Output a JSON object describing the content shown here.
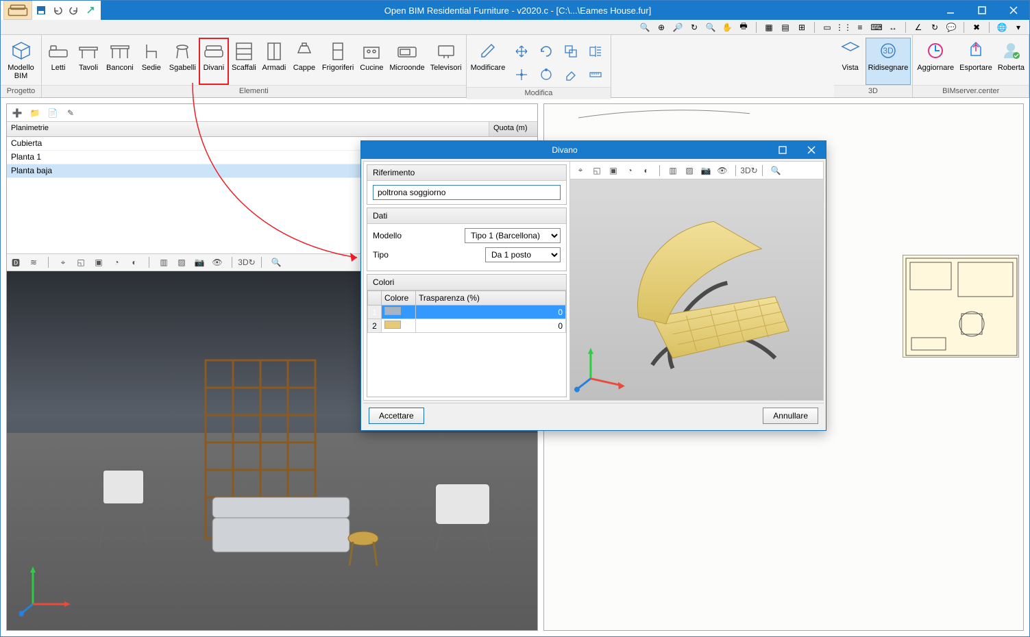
{
  "title": "Open BIM Residential Furniture - v2020.c - [C:\\...\\Eames House.fur]",
  "ribbon": {
    "groups": {
      "progetto": {
        "label": "Progetto",
        "items": [
          "Modello BIM"
        ],
        "names": [
          "modello-bim"
        ]
      },
      "elementi": {
        "label": "Elementi",
        "items": [
          "Letti",
          "Tavoli",
          "Banconi",
          "Sedie",
          "Sgabelli",
          "Divani",
          "Scaffali",
          "Armadi",
          "Cappe",
          "Frigoriferi",
          "Cucine",
          "Microonde",
          "Televisori"
        ],
        "names": [
          "letti",
          "tavoli",
          "banconi",
          "sedie",
          "sgabelli",
          "divani",
          "scaffali",
          "armadi",
          "cappe",
          "frigoriferi",
          "cucine",
          "microonde",
          "televisori"
        ]
      },
      "modifica": {
        "label": "Modifica",
        "modifyLabel": "Modificare"
      },
      "tred": {
        "label": "3D",
        "items": [
          "Vista",
          "Ridisegnare"
        ],
        "names": [
          "vista",
          "ridisegnare"
        ]
      },
      "bim": {
        "label": "BIMserver.center",
        "items": [
          "Aggiornare",
          "Esportare",
          "Roberta"
        ],
        "names": [
          "aggiornare",
          "esportare",
          "roberta"
        ]
      }
    }
  },
  "tree": {
    "header": {
      "name": "Planimetrie",
      "quota": "Quota (m)"
    },
    "rows": [
      "Cubierta",
      "Planta 1",
      "Planta baja"
    ],
    "selected": 2
  },
  "dialog": {
    "title": "Divano",
    "sections": {
      "riferimento": {
        "label": "Riferimento",
        "value": "poltrona soggiorno"
      },
      "dati": {
        "label": "Dati",
        "modello": {
          "label": "Modello",
          "value": "Tipo 1 (Barcellona)"
        },
        "tipo": {
          "label": "Tipo",
          "value": "Da 1 posto"
        }
      },
      "colori": {
        "label": "Colori",
        "headers": {
          "idx": "",
          "colore": "Colore",
          "trasparenza": "Trasparenza (%)"
        },
        "rows": [
          {
            "n": "1",
            "color": "#a6b4c6",
            "transp": "0"
          },
          {
            "n": "2",
            "color": "#e8c977",
            "transp": "0"
          }
        ]
      }
    },
    "buttons": {
      "ok": "Accettare",
      "cancel": "Annullare"
    }
  }
}
